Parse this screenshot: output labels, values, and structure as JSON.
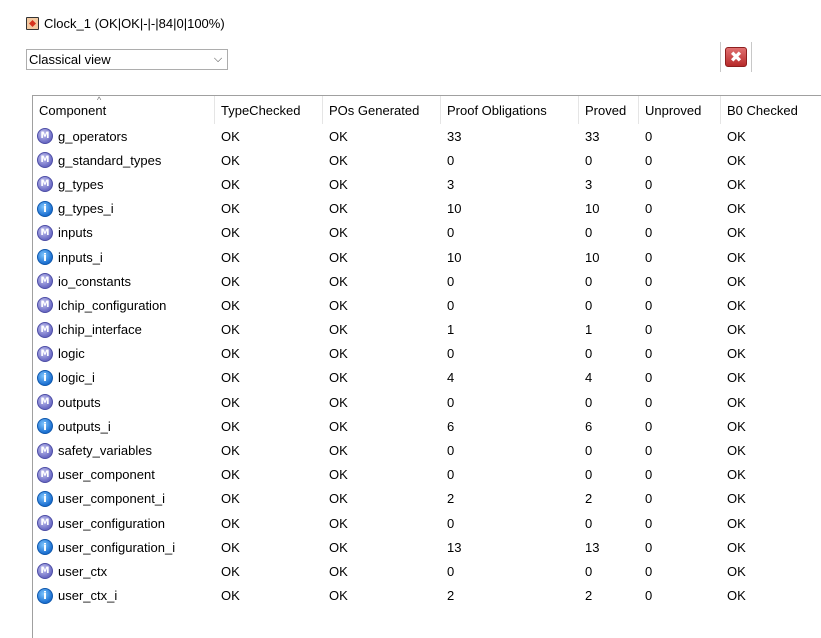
{
  "window": {
    "title": "Clock_1 (OK|OK|-|-|84|0|100%)"
  },
  "view_select": {
    "value": "Classical view"
  },
  "columns": [
    "Component",
    "TypeChecked",
    "POs Generated",
    "Proof Obligations",
    "Proved",
    "Unproved",
    "B0 Checked"
  ],
  "rows": [
    {
      "icon": "module-icon",
      "name": "g_operators",
      "tc": "OK",
      "pog": "OK",
      "po": "33",
      "proved": "33",
      "unproved": "0",
      "b0": "OK"
    },
    {
      "icon": "module-icon",
      "name": "g_standard_types",
      "tc": "OK",
      "pog": "OK",
      "po": "0",
      "proved": "0",
      "unproved": "0",
      "b0": "OK"
    },
    {
      "icon": "module-icon",
      "name": "g_types",
      "tc": "OK",
      "pog": "OK",
      "po": "3",
      "proved": "3",
      "unproved": "0",
      "b0": "OK"
    },
    {
      "icon": "implementation-icon",
      "name": "g_types_i",
      "tc": "OK",
      "pog": "OK",
      "po": "10",
      "proved": "10",
      "unproved": "0",
      "b0": "OK"
    },
    {
      "icon": "module-icon",
      "name": "inputs",
      "tc": "OK",
      "pog": "OK",
      "po": "0",
      "proved": "0",
      "unproved": "0",
      "b0": "OK"
    },
    {
      "icon": "implementation-icon",
      "name": "inputs_i",
      "tc": "OK",
      "pog": "OK",
      "po": "10",
      "proved": "10",
      "unproved": "0",
      "b0": "OK"
    },
    {
      "icon": "module-icon",
      "name": "io_constants",
      "tc": "OK",
      "pog": "OK",
      "po": "0",
      "proved": "0",
      "unproved": "0",
      "b0": "OK"
    },
    {
      "icon": "module-icon",
      "name": "lchip_configuration",
      "tc": "OK",
      "pog": "OK",
      "po": "0",
      "proved": "0",
      "unproved": "0",
      "b0": "OK"
    },
    {
      "icon": "module-icon",
      "name": "lchip_interface",
      "tc": "OK",
      "pog": "OK",
      "po": "1",
      "proved": "1",
      "unproved": "0",
      "b0": "OK"
    },
    {
      "icon": "module-icon",
      "name": "logic",
      "tc": "OK",
      "pog": "OK",
      "po": "0",
      "proved": "0",
      "unproved": "0",
      "b0": "OK"
    },
    {
      "icon": "implementation-icon",
      "name": "logic_i",
      "tc": "OK",
      "pog": "OK",
      "po": "4",
      "proved": "4",
      "unproved": "0",
      "b0": "OK"
    },
    {
      "icon": "module-icon",
      "name": "outputs",
      "tc": "OK",
      "pog": "OK",
      "po": "0",
      "proved": "0",
      "unproved": "0",
      "b0": "OK"
    },
    {
      "icon": "implementation-icon",
      "name": "outputs_i",
      "tc": "OK",
      "pog": "OK",
      "po": "6",
      "proved": "6",
      "unproved": "0",
      "b0": "OK"
    },
    {
      "icon": "module-icon",
      "name": "safety_variables",
      "tc": "OK",
      "pog": "OK",
      "po": "0",
      "proved": "0",
      "unproved": "0",
      "b0": "OK"
    },
    {
      "icon": "module-icon",
      "name": "user_component",
      "tc": "OK",
      "pog": "OK",
      "po": "0",
      "proved": "0",
      "unproved": "0",
      "b0": "OK"
    },
    {
      "icon": "implementation-icon",
      "name": "user_component_i",
      "tc": "OK",
      "pog": "OK",
      "po": "2",
      "proved": "2",
      "unproved": "0",
      "b0": "OK"
    },
    {
      "icon": "module-icon",
      "name": "user_configuration",
      "tc": "OK",
      "pog": "OK",
      "po": "0",
      "proved": "0",
      "unproved": "0",
      "b0": "OK"
    },
    {
      "icon": "implementation-icon",
      "name": "user_configuration_i",
      "tc": "OK",
      "pog": "OK",
      "po": "13",
      "proved": "13",
      "unproved": "0",
      "b0": "OK"
    },
    {
      "icon": "module-icon",
      "name": "user_ctx",
      "tc": "OK",
      "pog": "OK",
      "po": "0",
      "proved": "0",
      "unproved": "0",
      "b0": "OK"
    },
    {
      "icon": "implementation-icon",
      "name": "user_ctx_i",
      "tc": "OK",
      "pog": "OK",
      "po": "2",
      "proved": "2",
      "unproved": "0",
      "b0": "OK"
    }
  ],
  "icons": {
    "module-icon": "M",
    "implementation-icon": "i",
    "close": "✖",
    "dropdown": "⌵",
    "sort": "^"
  }
}
